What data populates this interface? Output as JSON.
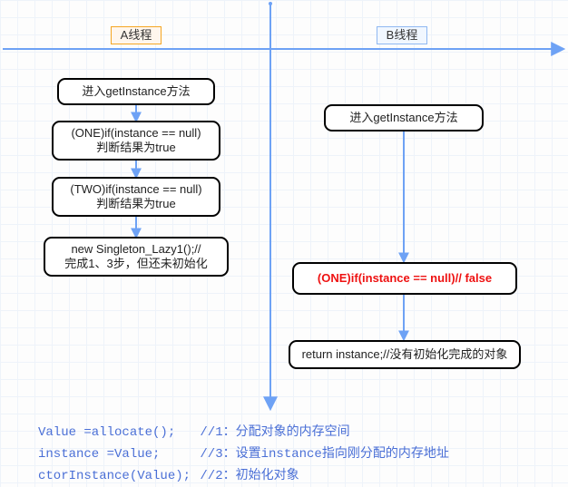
{
  "columns": {
    "a_label": "A线程",
    "b_label": "B线程"
  },
  "threadA": {
    "s1": "进入getInstance方法",
    "s2_l1": "(ONE)if(instance == null)",
    "s2_l2": "判断结果为true",
    "s3_l1": "(TWO)if(instance == null)",
    "s3_l2": "判断结果为true",
    "s4_l1": "new Singleton_Lazy1();//",
    "s4_l2": "完成1、3步，但还未初始化"
  },
  "threadB": {
    "s1": "进入getInstance方法",
    "s2": "(ONE)if(instance == null)// false",
    "s3": "return instance;//没有初始化完成的对象"
  },
  "notes": {
    "l1_code": "Value =allocate();",
    "l1_comment": "//1：分配对象的内存空间",
    "l2_code": "instance =Value;",
    "l2_comment": "//3：设置instance指向刚分配的内存地址",
    "l3_code": "ctorInstance(Value);",
    "l3_comment": "//2：初始化对象"
  },
  "chart_data": {
    "type": "flowchart",
    "columns": [
      {
        "id": "A",
        "label": "A线程"
      },
      {
        "id": "B",
        "label": "B线程"
      }
    ],
    "nodes": [
      {
        "id": "a1",
        "column": "A",
        "text": "进入getInstance方法"
      },
      {
        "id": "a2",
        "column": "A",
        "text": "(ONE)if(instance == null) 判断结果为true"
      },
      {
        "id": "a3",
        "column": "A",
        "text": "(TWO)if(instance == null) 判断结果为true"
      },
      {
        "id": "a4",
        "column": "A",
        "text": "new Singleton_Lazy1();// 完成1、3步，但还未初始化"
      },
      {
        "id": "b1",
        "column": "B",
        "text": "进入getInstance方法"
      },
      {
        "id": "b2",
        "column": "B",
        "text": "(ONE)if(instance == null)// false",
        "highlight": true
      },
      {
        "id": "b3",
        "column": "B",
        "text": "return instance;//没有初始化完成的对象"
      }
    ],
    "edges": [
      {
        "from": "a1",
        "to": "a2"
      },
      {
        "from": "a2",
        "to": "a3"
      },
      {
        "from": "a3",
        "to": "a4"
      },
      {
        "from": "b1",
        "to": "b2"
      },
      {
        "from": "b2",
        "to": "b3"
      }
    ],
    "legend": [
      {
        "code": "Value =allocate();",
        "step": 1,
        "desc": "分配对象的内存空间"
      },
      {
        "code": "instance =Value;",
        "step": 3,
        "desc": "设置instance指向刚分配的内存地址"
      },
      {
        "code": "ctorInstance(Value);",
        "step": 2,
        "desc": "初始化对象"
      }
    ]
  }
}
